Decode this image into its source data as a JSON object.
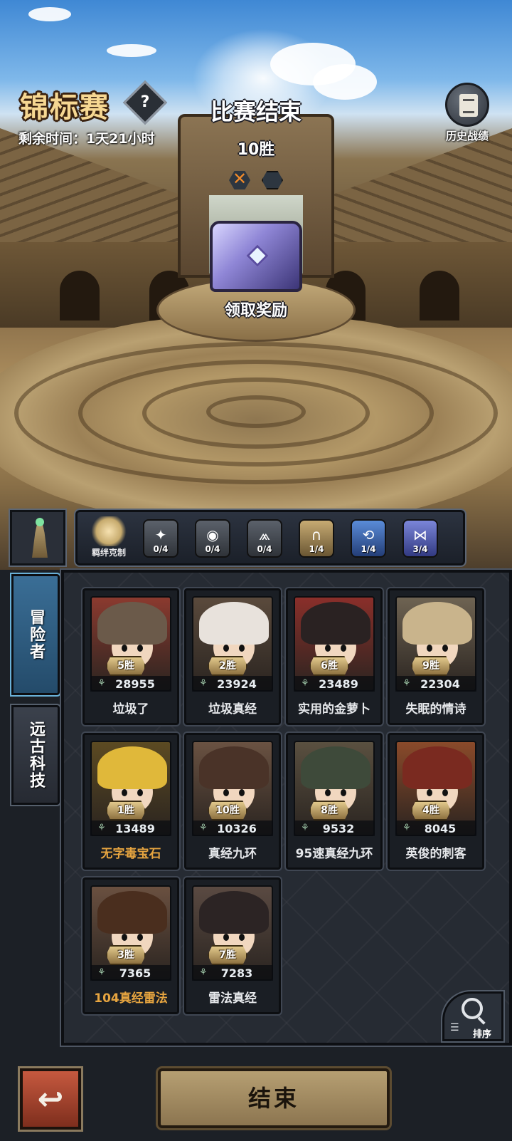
{
  "header": {
    "title": "锦标赛",
    "help_glyph": "?",
    "remaining_time": "剩余时间：1天21小时",
    "status": "比赛结束",
    "wins": "10胜",
    "claim_reward": "领取奖励",
    "history_label": "历史战绩"
  },
  "synergy": {
    "label": "羁绊克制",
    "items": [
      {
        "glyph": "✦",
        "count": "0/4",
        "style": "grey"
      },
      {
        "glyph": "◉",
        "count": "0/4",
        "style": "grey"
      },
      {
        "glyph": "⩕",
        "count": "0/4",
        "style": "grey"
      },
      {
        "glyph": "∩",
        "count": "1/4",
        "style": "gold"
      },
      {
        "glyph": "⟲",
        "count": "1/4",
        "style": "blue"
      },
      {
        "glyph": "⋈",
        "count": "3/4",
        "style": "purple"
      }
    ]
  },
  "tabs": {
    "adventurers": "冒险者",
    "ancient_tech": "远古科技"
  },
  "heroes": [
    {
      "name": "垃圾了",
      "wins": "5胜",
      "power": "28955",
      "name_color": "normal",
      "hair": "#6b5a4a",
      "bg": "#8b3a2f"
    },
    {
      "name": "垃圾真经",
      "wins": "2胜",
      "power": "23924",
      "name_color": "normal",
      "hair": "#e8e2dc",
      "bg": "#5a4a3c"
    },
    {
      "name": "实用的金萝卜",
      "wins": "6胜",
      "power": "23489",
      "name_color": "normal",
      "hair": "#2a2222",
      "bg": "#8a2f2a"
    },
    {
      "name": "失眠的情诗",
      "wins": "9胜",
      "power": "22304",
      "name_color": "normal",
      "hair": "#c9b48c",
      "bg": "#6e6352"
    },
    {
      "name": "无字毒宝石",
      "wins": "1胜",
      "power": "13489",
      "name_color": "gold",
      "hair": "#e0b83a",
      "bg": "#5c4a22"
    },
    {
      "name": "真经九环",
      "wins": "10胜",
      "power": "10326",
      "name_color": "normal",
      "hair": "#4a3328",
      "bg": "#6a5242"
    },
    {
      "name": "95速真经九环",
      "wins": "8胜",
      "power": "9532",
      "name_color": "normal",
      "hair": "#3e4a3a",
      "bg": "#5a5040"
    },
    {
      "name": "英俊的刺客",
      "wins": "4胜",
      "power": "8045",
      "name_color": "normal",
      "hair": "#7a2a20",
      "bg": "#8a4a2a"
    },
    {
      "name": "104真经雷法",
      "wins": "3胜",
      "power": "7365",
      "name_color": "gold",
      "hair": "#4a2e1e",
      "bg": "#6a5040"
    },
    {
      "name": "雷法真经",
      "wins": "7胜",
      "power": "7283",
      "name_color": "normal",
      "hair": "#2c2424",
      "bg": "#5a4a42"
    }
  ],
  "sort_label": "排序",
  "end_button": "结束",
  "back_glyph": "↩"
}
